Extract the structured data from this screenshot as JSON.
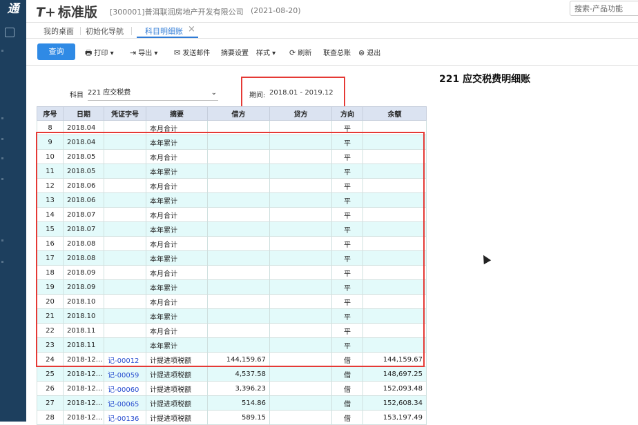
{
  "app": {
    "rail_logo": "通",
    "brand_prefix": "T+",
    "brand_name": "标准版",
    "company": "[300001]普洱联润房地产开发有限公司",
    "date": "(2021-08-20)",
    "search_placeholder": "搜索-产品功能"
  },
  "tabs": [
    {
      "label": "我的桌面"
    },
    {
      "label": "初始化导航"
    },
    {
      "label": "科目明细账"
    }
  ],
  "toolbar": {
    "query": "查询",
    "print": "打印",
    "export": "导出",
    "send_mail": "发送邮件",
    "summary_settings": "摘要设置",
    "style": "样式",
    "refresh": "刷新",
    "linked_ledger": "联查总账",
    "exit": "退出"
  },
  "report": {
    "title": "221 应交税费明细账",
    "subject_label": "科目",
    "subject_value": "221 应交税费",
    "period_label": "期间:",
    "period_value": "2018.01 - 2019.12"
  },
  "table": {
    "headers": [
      "序号",
      "日期",
      "凭证字号",
      "摘要",
      "借方",
      "贷方",
      "方向",
      "余额"
    ],
    "rows": [
      {
        "seq": "8",
        "date": "2018.04",
        "voucher": "",
        "summary": "本月合计",
        "debit": "",
        "credit": "",
        "dir": "平",
        "balance": ""
      },
      {
        "seq": "9",
        "date": "2018.04",
        "voucher": "",
        "summary": "本年累计",
        "debit": "",
        "credit": "",
        "dir": "平",
        "balance": ""
      },
      {
        "seq": "10",
        "date": "2018.05",
        "voucher": "",
        "summary": "本月合计",
        "debit": "",
        "credit": "",
        "dir": "平",
        "balance": ""
      },
      {
        "seq": "11",
        "date": "2018.05",
        "voucher": "",
        "summary": "本年累计",
        "debit": "",
        "credit": "",
        "dir": "平",
        "balance": ""
      },
      {
        "seq": "12",
        "date": "2018.06",
        "voucher": "",
        "summary": "本月合计",
        "debit": "",
        "credit": "",
        "dir": "平",
        "balance": ""
      },
      {
        "seq": "13",
        "date": "2018.06",
        "voucher": "",
        "summary": "本年累计",
        "debit": "",
        "credit": "",
        "dir": "平",
        "balance": ""
      },
      {
        "seq": "14",
        "date": "2018.07",
        "voucher": "",
        "summary": "本月合计",
        "debit": "",
        "credit": "",
        "dir": "平",
        "balance": ""
      },
      {
        "seq": "15",
        "date": "2018.07",
        "voucher": "",
        "summary": "本年累计",
        "debit": "",
        "credit": "",
        "dir": "平",
        "balance": ""
      },
      {
        "seq": "16",
        "date": "2018.08",
        "voucher": "",
        "summary": "本月合计",
        "debit": "",
        "credit": "",
        "dir": "平",
        "balance": ""
      },
      {
        "seq": "17",
        "date": "2018.08",
        "voucher": "",
        "summary": "本年累计",
        "debit": "",
        "credit": "",
        "dir": "平",
        "balance": ""
      },
      {
        "seq": "18",
        "date": "2018.09",
        "voucher": "",
        "summary": "本月合计",
        "debit": "",
        "credit": "",
        "dir": "平",
        "balance": ""
      },
      {
        "seq": "19",
        "date": "2018.09",
        "voucher": "",
        "summary": "本年累计",
        "debit": "",
        "credit": "",
        "dir": "平",
        "balance": ""
      },
      {
        "seq": "20",
        "date": "2018.10",
        "voucher": "",
        "summary": "本月合计",
        "debit": "",
        "credit": "",
        "dir": "平",
        "balance": ""
      },
      {
        "seq": "21",
        "date": "2018.10",
        "voucher": "",
        "summary": "本年累计",
        "debit": "",
        "credit": "",
        "dir": "平",
        "balance": ""
      },
      {
        "seq": "22",
        "date": "2018.11",
        "voucher": "",
        "summary": "本月合计",
        "debit": "",
        "credit": "",
        "dir": "平",
        "balance": ""
      },
      {
        "seq": "23",
        "date": "2018.11",
        "voucher": "",
        "summary": "本年累计",
        "debit": "",
        "credit": "",
        "dir": "平",
        "balance": ""
      },
      {
        "seq": "24",
        "date": "2018-12...",
        "voucher": "记-00012",
        "summary": "计提进项税额",
        "debit": "144,159.67",
        "credit": "",
        "dir": "借",
        "balance": "144,159.67"
      },
      {
        "seq": "25",
        "date": "2018-12...",
        "voucher": "记-00059",
        "summary": "计提进项税额",
        "debit": "4,537.58",
        "credit": "",
        "dir": "借",
        "balance": "148,697.25"
      },
      {
        "seq": "26",
        "date": "2018-12...",
        "voucher": "记-00060",
        "summary": "计提进项税额",
        "debit": "3,396.23",
        "credit": "",
        "dir": "借",
        "balance": "152,093.48"
      },
      {
        "seq": "27",
        "date": "2018-12...",
        "voucher": "记-00065",
        "summary": "计提进项税额",
        "debit": "514.86",
        "credit": "",
        "dir": "借",
        "balance": "152,608.34"
      },
      {
        "seq": "28",
        "date": "2018-12...",
        "voucher": "记-00136",
        "summary": "计提进项税额",
        "debit": "589.15",
        "credit": "",
        "dir": "借",
        "balance": "153,197.49"
      }
    ]
  },
  "colors": {
    "accent": "#2f8ae5",
    "highlight_box": "#e53935",
    "row_alt": "#e3fafa",
    "header_bg": "#dbe3f1",
    "rail": "#1d3f5e"
  }
}
